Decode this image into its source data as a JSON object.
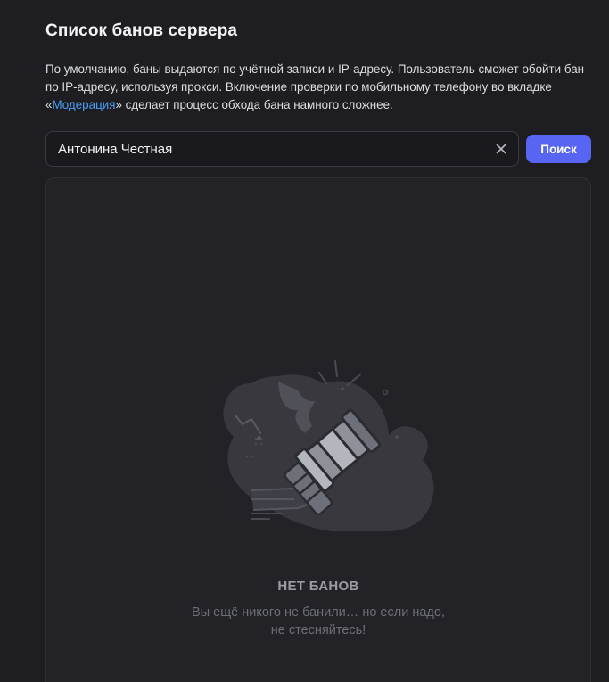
{
  "header": {
    "title": "Список банов сервера"
  },
  "description": {
    "line1": "По умолчанию, баны выдаются по учётной записи и IP-адресу. Пользователь сможет обойти бан по IP-адресу, используя прокси. Включение проверки по мобильному телефону во вкладке «",
    "link": "Модерация",
    "line2": "» сделает процесс обхода бана намного сложнее."
  },
  "search": {
    "value": "Антонина Честная",
    "button_label": "Поиск"
  },
  "empty_state": {
    "title": "НЕТ БАНОВ",
    "line1": "Вы ещё никого не банили… но если надо,",
    "line2": "не стесняйтесь!"
  },
  "colors": {
    "accent": "#5865f2",
    "link": "#4d9df7",
    "background": "#1e1e22"
  }
}
